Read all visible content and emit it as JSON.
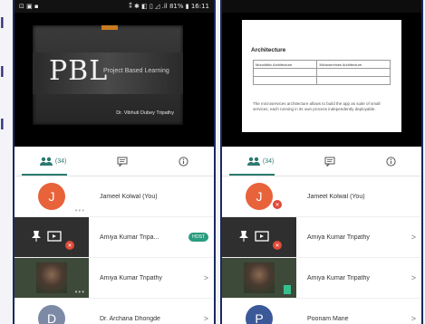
{
  "edge_fragments": [
    "l",
    "l",
    "l"
  ],
  "left_phone": {
    "status_left": "⊡ ▣ ▪",
    "status_right": "⁑ ✱ ◧ ▯ ◿ .il 81% ▮ 16:11",
    "slide": {
      "pbl": "PBL",
      "tagline": "Project Based Learning",
      "author": "Dr. Vibhuti Dubey Tripathy"
    },
    "tabs": [
      {
        "label": "(34)",
        "icon": "people-icon"
      },
      {
        "label": "",
        "icon": "chat-icon"
      },
      {
        "label": "",
        "icon": "info-icon"
      }
    ],
    "participants": [
      {
        "initial": "J",
        "name": "Jameel Kolwal (You)",
        "color": "#e8623a"
      },
      {
        "name": "Amiya Kumar Tripa...",
        "badge": "HOST"
      },
      {
        "name": "Amiya Kumar Tripathy"
      },
      {
        "initial": "D",
        "name": "Dr. Archana Dhongde",
        "color": "#7c8aa6"
      }
    ]
  },
  "right_phone": {
    "slide": {
      "title": "Architecture",
      "table_rows": [
        [
          "Monolithic Architecture",
          "Microservices Architecture"
        ],
        [
          "",
          ""
        ],
        [
          "",
          ""
        ]
      ],
      "note": "The microservices architecture allows to build the app as suite of small services, each running in its own process independently deployable."
    },
    "tabs": [
      {
        "label": "(34)",
        "icon": "people-icon"
      },
      {
        "label": "",
        "icon": "chat-icon"
      },
      {
        "label": "",
        "icon": "info-icon"
      }
    ],
    "participants": [
      {
        "initial": "J",
        "name": "Jameel Kolwal (You)",
        "color": "#e8623a"
      },
      {
        "name": "Amiya Kumar Tripathy"
      },
      {
        "name": "Amiya Kumar Tripathy"
      },
      {
        "initial": "P",
        "name": "Poonam Mane",
        "color": "#3b5998"
      }
    ]
  }
}
